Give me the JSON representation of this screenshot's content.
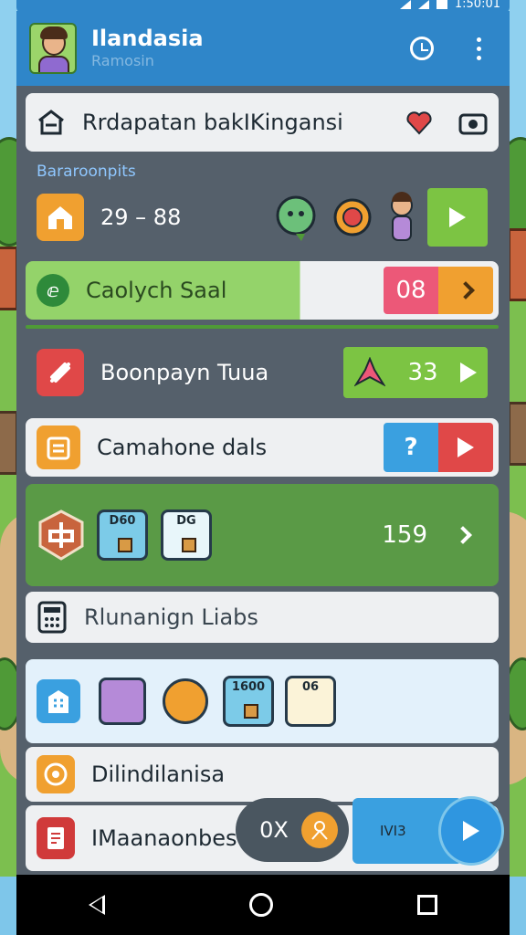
{
  "app": {
    "title": "Ilandasia",
    "subtitle": "Ramosin"
  },
  "status": {
    "time": "1:50:01"
  },
  "rows": {
    "header_card": {
      "label": "Rrdapatan bakIKingansi"
    },
    "section_label": "Bararoonpits",
    "score_card": {
      "label": "29 – 88"
    },
    "green_card": {
      "label": "Caolych Saal",
      "badge": "08"
    },
    "dark_card": {
      "label": "Boonpayn Tuua",
      "badge": "33"
    },
    "light_card": {
      "label": "Camahone dals"
    },
    "green_panel": {
      "tile1": "D60",
      "tile2": "DG",
      "count": "159"
    },
    "gray_card": {
      "label": "Rlunanign Liabs"
    },
    "tiles_panel": {
      "tile1": "1600",
      "tile2": "06"
    },
    "orange_card": {
      "label": "Dilindilanisa"
    },
    "bottom_card": {
      "label": "IMaanaonbes"
    }
  },
  "fab": {
    "pill_label": "0X",
    "blue_label": "IVI3"
  },
  "colors": {
    "appbar": "#2f86c9",
    "accent_green": "#7cc443",
    "accent_red": "#e04848",
    "accent_orange": "#f0a030",
    "accent_blue": "#3aa0e0"
  }
}
